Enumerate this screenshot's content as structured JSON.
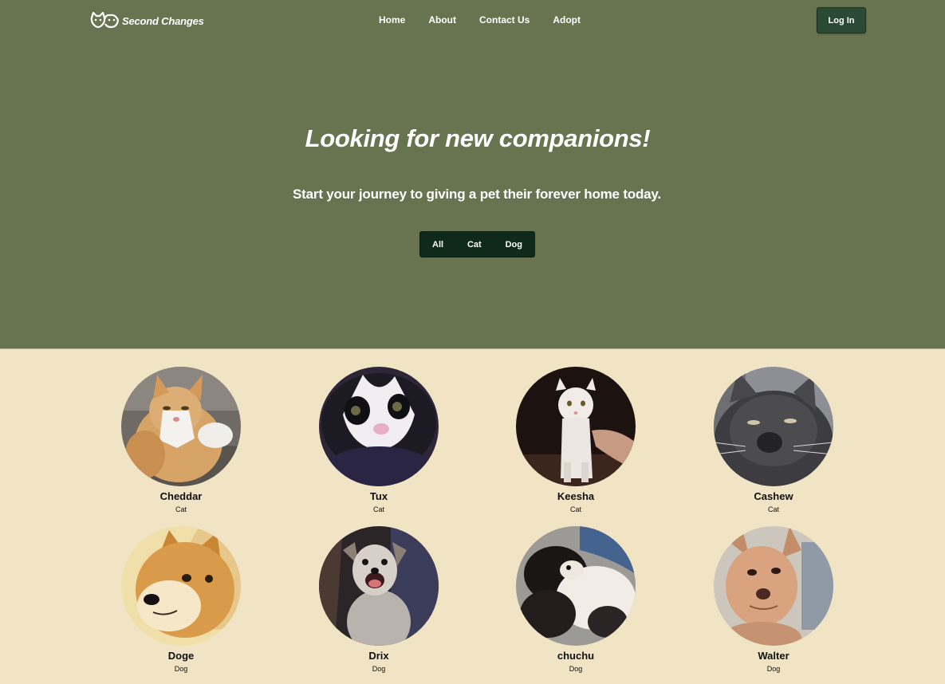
{
  "brand": {
    "name": "Second Changes",
    "logo_icon": "cat-dog-heads-logo"
  },
  "nav": {
    "links": [
      "Home",
      "About",
      "Contact Us",
      "Adopt"
    ],
    "login_label": "Log In"
  },
  "hero": {
    "title": "Looking for new companions!",
    "subtitle": "Start your journey to giving a pet their forever home today.",
    "filters": [
      "All",
      "Cat",
      "Dog"
    ]
  },
  "pets": [
    {
      "name": "Cheddar",
      "type": "Cat"
    },
    {
      "name": "Tux",
      "type": "Cat"
    },
    {
      "name": "Keesha",
      "type": "Cat"
    },
    {
      "name": "Cashew",
      "type": "Cat"
    },
    {
      "name": "Doge",
      "type": "Dog"
    },
    {
      "name": "Drix",
      "type": "Dog"
    },
    {
      "name": "chuchu",
      "type": "Dog"
    },
    {
      "name": "Walter",
      "type": "Dog"
    }
  ],
  "colors": {
    "hero_bg": "#687450",
    "page_bg": "#f0e4c4",
    "login_bg": "#2b4a36",
    "filter_bg": "#0f2a18"
  }
}
